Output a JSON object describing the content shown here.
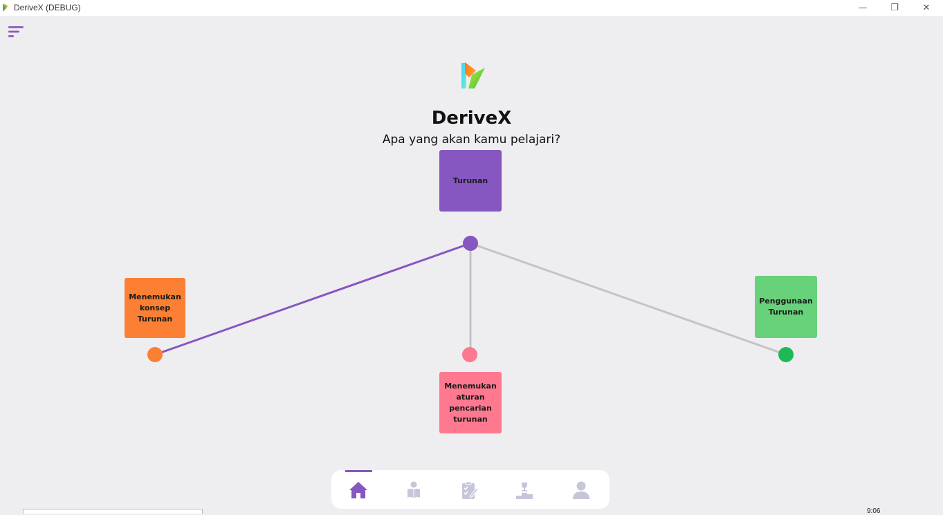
{
  "window": {
    "title": "DeriveX (DEBUG)",
    "minimize_glyph": "—",
    "maximize_glyph": "❐",
    "close_glyph": "✕"
  },
  "header": {
    "app_name": "DeriveX",
    "subtitle": "Apa yang akan kamu pelajari?"
  },
  "topics": {
    "root": "Turunan",
    "konsep": "Menemukan\nkonsep\nTurunan",
    "aturan": "Menemukan\naturan\npencarian\nturunan",
    "penggunaan": "Penggunaan\nTurunan"
  },
  "colors": {
    "accent": "#8656c1",
    "konsep": "#fb8033",
    "aturan": "#fe7890",
    "penggunaan": "#68d27a",
    "penggunaan_node": "#1db954",
    "inactive_line": "#c4c4c6",
    "inactive_icon": "#c5c6d8"
  },
  "bottom_nav": {
    "active": "home",
    "items": [
      "home-icon",
      "reading-icon",
      "quiz-icon",
      "leaderboard-icon",
      "profile-icon"
    ]
  },
  "clock": "9:06"
}
